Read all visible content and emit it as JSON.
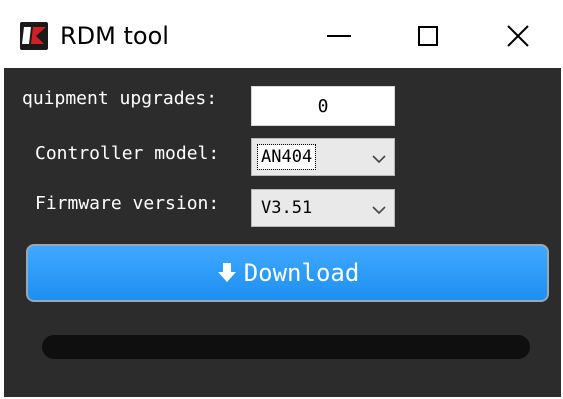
{
  "window": {
    "title": "RDM tool"
  },
  "form": {
    "equipment_label": "quipment upgrades:",
    "equipment_value": "0",
    "controller_label": "Controller model:",
    "controller_value": "AN404",
    "firmware_label": "Firmware version:",
    "firmware_value": "V3.51"
  },
  "actions": {
    "download_label": "Download"
  },
  "progress": {
    "fraction": 0
  },
  "icons": {
    "logo": "rdm-logo-icon",
    "minimize": "minimize-icon",
    "maximize": "maximize-icon",
    "close": "close-icon",
    "dropdown": "chevron-down-icon",
    "download": "download-arrow-icon"
  },
  "colors": {
    "accent": "#1e8ff0",
    "background": "#2c2c2c",
    "logo_red": "#d11f26"
  }
}
